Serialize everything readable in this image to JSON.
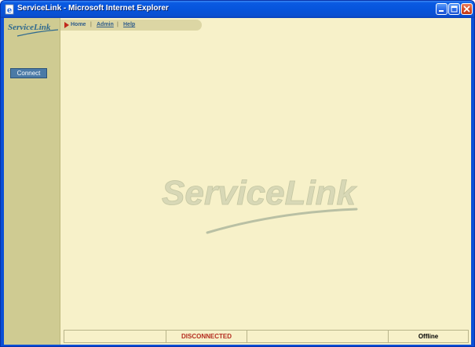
{
  "window": {
    "title": "ServiceLink - Microsoft Internet Explorer",
    "title_icon": "ie-page-icon",
    "controls": [
      "minimize-icon",
      "maximize-icon",
      "close-icon"
    ]
  },
  "sidebar": {
    "logo_text": "ServiceLink",
    "connect_label": "Connect"
  },
  "nav": {
    "current_marker_icon": "triangle-right-icon",
    "items": [
      {
        "label": "Home",
        "active": true
      },
      {
        "label": "Admin",
        "active": false
      },
      {
        "label": "Help",
        "active": false
      }
    ],
    "separator": "|"
  },
  "main": {
    "watermark_text": "ServiceLink"
  },
  "statusbar": {
    "cells": [
      "",
      "DISCONNECTED",
      "",
      "Offline"
    ]
  },
  "colors": {
    "page_background": "#f7f1c9",
    "sidebar_background": "#cfcb92",
    "connect_button": "#4b7aa6",
    "link": "#2e5c8a",
    "status_alert": "#b32b1e",
    "titlebar": "#0654dc"
  }
}
